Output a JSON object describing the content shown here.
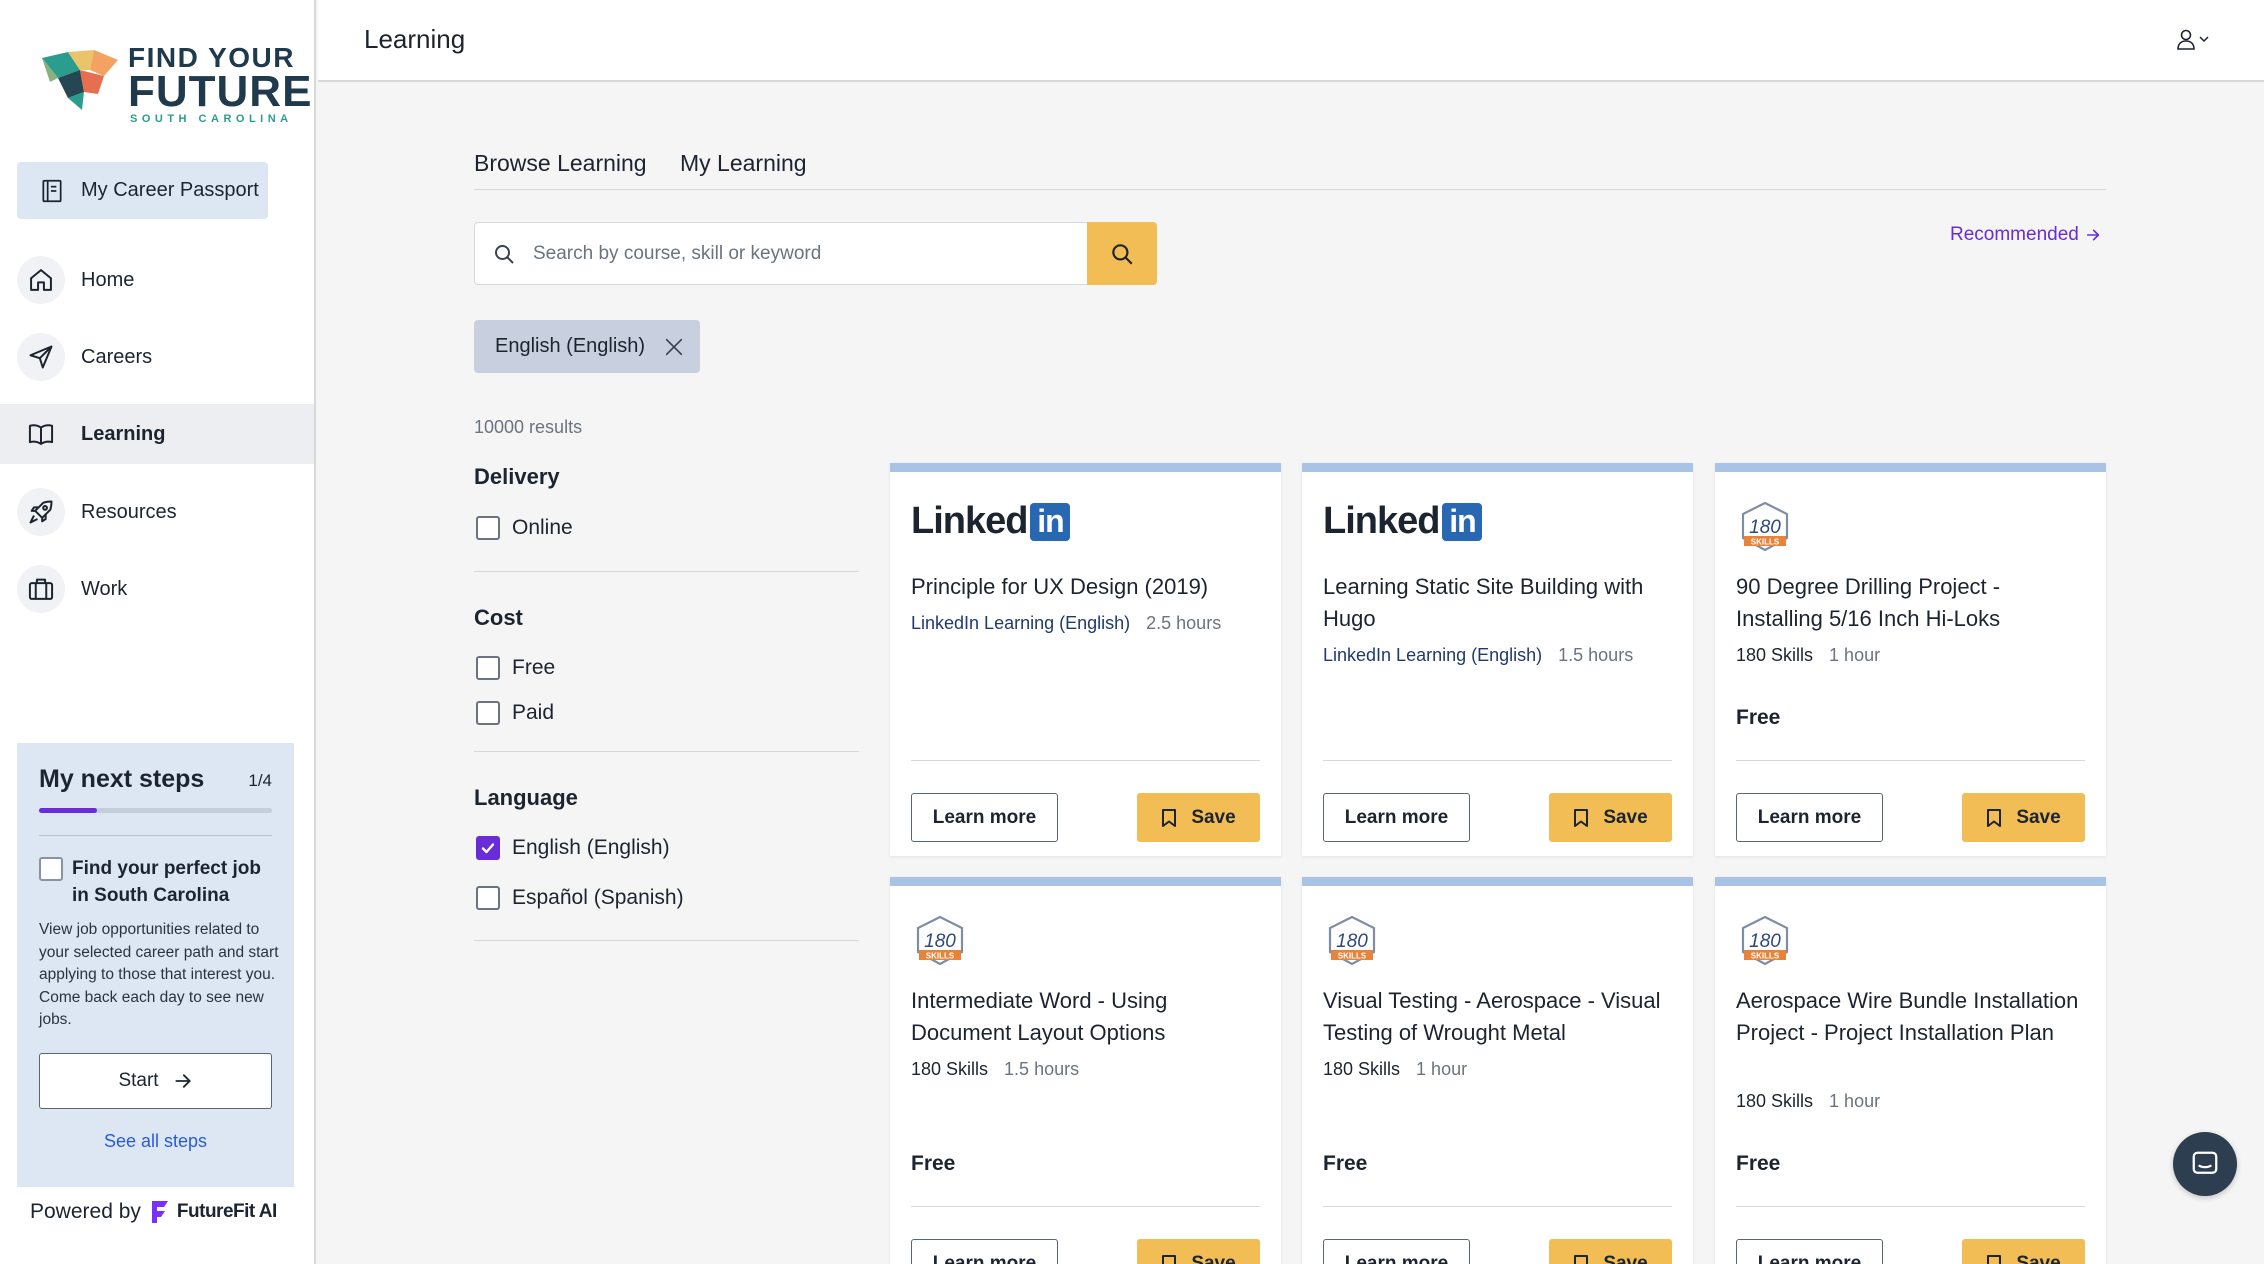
{
  "brand": {
    "line1": "FIND YOUR",
    "line2": "FUTURE",
    "line3": "SOUTH CAROLINA",
    "powered_by": "Powered by",
    "partner": "FutureFit AI"
  },
  "sidebar": {
    "passport": "My Career Passport",
    "items": [
      {
        "label": "Home",
        "icon": "home-icon"
      },
      {
        "label": "Careers",
        "icon": "send-icon"
      },
      {
        "label": "Learning",
        "icon": "book-icon",
        "active": true
      },
      {
        "label": "Resources",
        "icon": "rocket-icon"
      },
      {
        "label": "Work",
        "icon": "briefcase-icon"
      }
    ]
  },
  "next_steps": {
    "title": "My next steps",
    "count": "1/4",
    "progress": 0.25,
    "job_title": "Find your perfect job in South Carolina",
    "description": "View job opportunities related to your selected career path and start applying to those that interest you. Come back each day to see new jobs.",
    "start": "Start",
    "see_all": "See all steps"
  },
  "header": {
    "title": "Learning"
  },
  "tabs": [
    "Browse Learning",
    "My Learning"
  ],
  "search": {
    "placeholder": "Search by course, skill or keyword",
    "value": ""
  },
  "recommended": "Recommended",
  "chip": "English (English)",
  "results": "10000 results",
  "filters": {
    "delivery": {
      "title": "Delivery",
      "options": [
        {
          "label": "Online",
          "checked": false
        }
      ]
    },
    "cost": {
      "title": "Cost",
      "options": [
        {
          "label": "Free",
          "checked": false
        },
        {
          "label": "Paid",
          "checked": false
        }
      ]
    },
    "language": {
      "title": "Language",
      "options": [
        {
          "label": "English (English)",
          "checked": true
        },
        {
          "label": "Español (Spanish)",
          "checked": false
        }
      ]
    }
  },
  "buttons": {
    "learn_more": "Learn more",
    "save": "Save"
  },
  "cards": [
    {
      "logo": "LinkedIn",
      "logo_main": "Linked",
      "logo_in": "in",
      "title": "Principle for UX Design (2019)",
      "provider": "LinkedIn Learning (English)",
      "duration": "2.5 hours",
      "price": ""
    },
    {
      "logo": "LinkedIn",
      "logo_main": "Linked",
      "logo_in": "in",
      "title": "Learning Static Site Building with Hugo",
      "provider": "LinkedIn Learning (English)",
      "duration": "1.5 hours",
      "price": ""
    },
    {
      "logo": "180 Skills",
      "title": "90 Degree Drilling Project - Installing 5/16 Inch Hi-Loks",
      "provider": "180 Skills",
      "duration": "1 hour",
      "price": "Free"
    },
    {
      "logo": "180 Skills",
      "title": "Intermediate Word - Using Document Layout Options",
      "provider": "180 Skills",
      "duration": "1.5 hours",
      "price": "Free"
    },
    {
      "logo": "180 Skills",
      "title": "Visual Testing - Aerospace - Visual Testing of Wrought Metal",
      "provider": "180 Skills",
      "duration": "1 hour",
      "price": "Free"
    },
    {
      "logo": "180 Skills",
      "title": "Aerospace Wire Bundle Installation Project - Project Installation Plan",
      "provider": "180 Skills",
      "duration": "1 hour",
      "price": "Free"
    }
  ],
  "colors": {
    "accent": "#6a2bd9",
    "save": "#f2bd55",
    "card_top": "#a9c3e6",
    "sidebar_tint": "#dde7f3"
  }
}
